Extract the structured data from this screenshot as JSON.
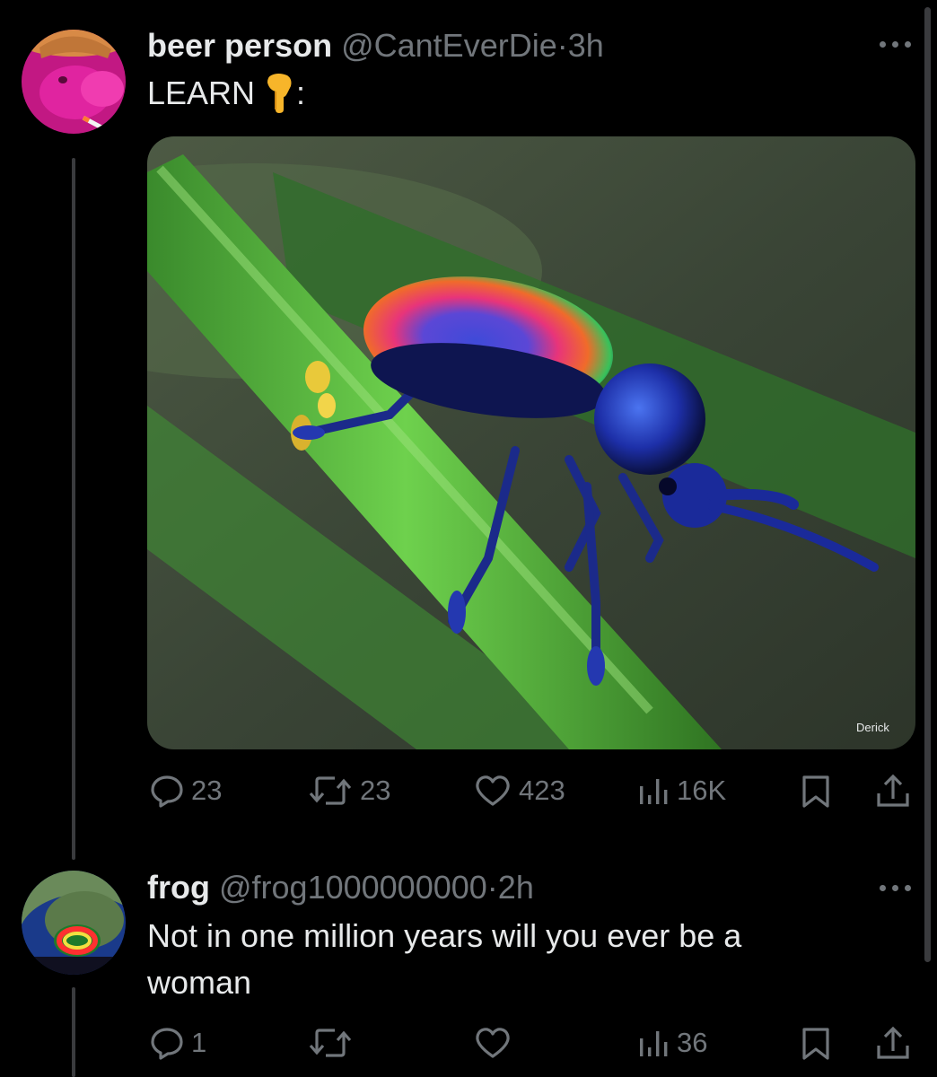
{
  "tweet1": {
    "display_name": "beer person",
    "handle": "@CantEverDie",
    "separator": "·",
    "time": "3h",
    "text_prefix": "LEARN ",
    "text_suffix": ":",
    "text_emoji": "backhand-index-pointing-down",
    "media_credit": "Derick",
    "reply_count": "23",
    "repost_count": "23",
    "like_count": "423",
    "view_count": "16K"
  },
  "tweet2": {
    "display_name": "frog",
    "handle": "@frog1000000000",
    "separator": "·",
    "time": "2h",
    "text_line1": "Not in one million years will you ever be a",
    "text_line2": "woman",
    "reply_count": "1",
    "repost_count": "",
    "like_count": "",
    "view_count": "36"
  },
  "colors": {
    "background": "#000000",
    "primary_text": "#e7e9ea",
    "secondary_text": "#71767b",
    "thread_line": "#3a3b3e"
  },
  "icons": [
    "reply-icon",
    "repost-icon",
    "like-icon",
    "views-icon",
    "bookmark-icon",
    "share-icon",
    "more-icon"
  ]
}
